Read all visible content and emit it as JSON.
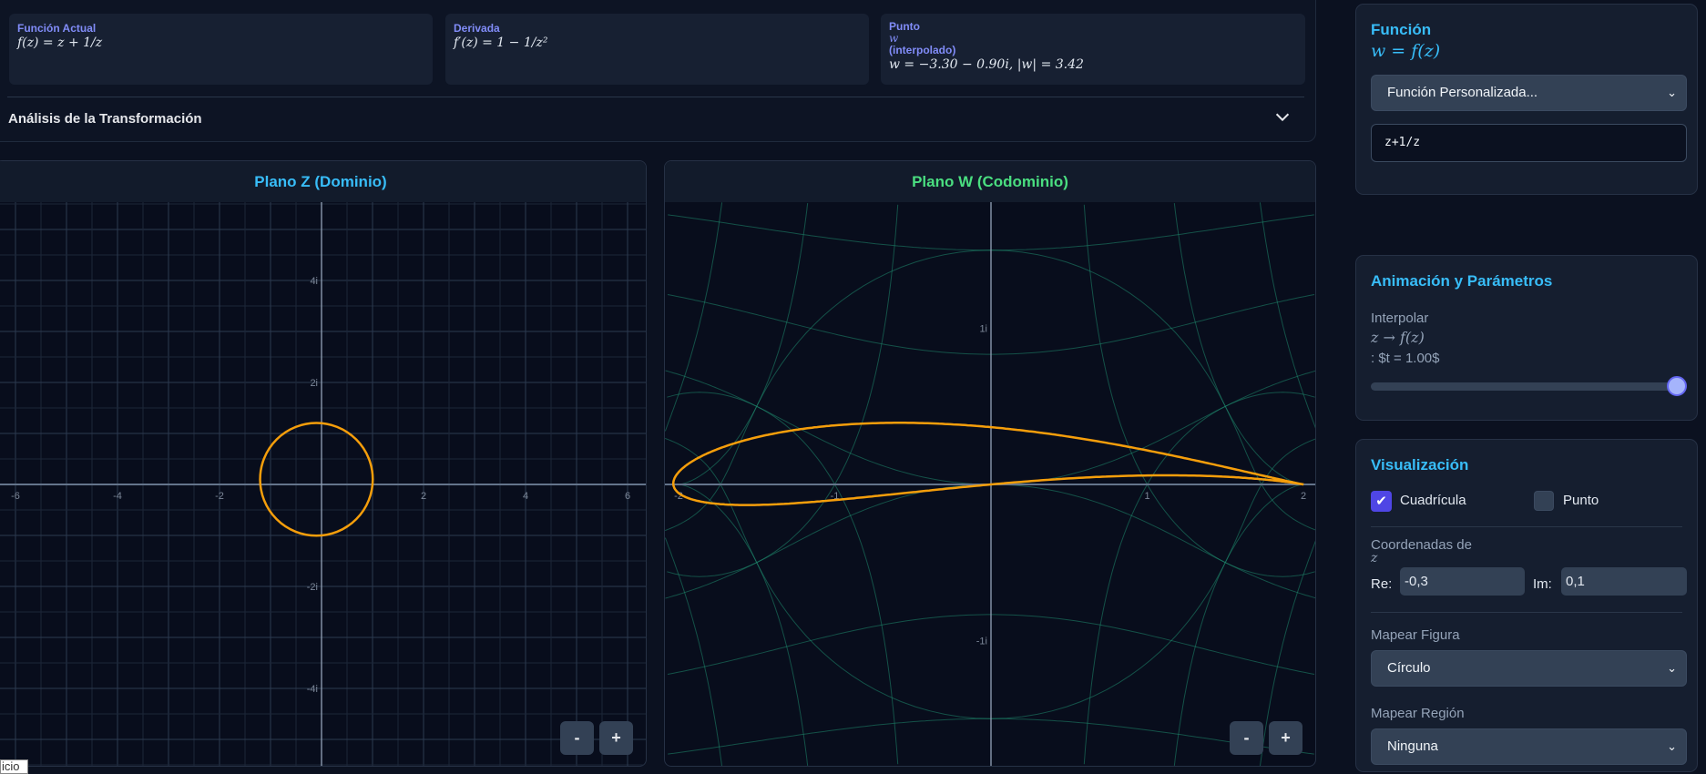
{
  "analysis": {
    "cards": [
      {
        "label": "Función Actual",
        "value": "f(z) = z + 1/z"
      },
      {
        "label": "Derivada",
        "value": "f′(z) = 1 − 1/z²"
      },
      {
        "label_line1": "Punto",
        "label_math": "w",
        "label_line2": "(interpolado)",
        "value": "w = −3.30 − 0.90i, |w| = 3.42"
      }
    ],
    "title": "Análisis de la Transformación",
    "toggle_icon": "chevron-down-icon"
  },
  "z_plane": {
    "title": "Plano Z (Dominio)",
    "x_ticks": [
      "-6",
      "-4",
      "-2",
      "2",
      "4",
      "6"
    ],
    "y_ticks": [
      "4i",
      "2i",
      "-2i",
      "-4i"
    ],
    "zoom_out": "-",
    "zoom_in": "+"
  },
  "w_plane": {
    "title": "Plano W (Codominio)",
    "x_ticks": [
      "-2",
      "-1",
      "1",
      "2"
    ],
    "y_ticks": [
      "1i",
      "-1i"
    ],
    "zoom_out": "-",
    "zoom_in": "+"
  },
  "tooltip": "icio",
  "sidebar": {
    "funcion": {
      "title": "Función",
      "subtitle_math": "w = f(z)",
      "select_value": "Función Personalizada...",
      "input_value": "z+1/z"
    },
    "animacion": {
      "title": "Animación y Parámetros",
      "interp_label": "Interpolar",
      "interp_math": "z → f(z)",
      "interp_value": ": $t = 1.00$",
      "slider_value": 1.0
    },
    "visualizacion": {
      "title": "Visualización",
      "grid_label": "Cuadrícula",
      "grid_checked": true,
      "point_label": "Punto",
      "point_checked": false,
      "coords_label": "Coordenadas de",
      "coords_math": "z",
      "re_label": "Re:",
      "re_value": "-0,3",
      "im_label": "Im:",
      "im_value": "0,1",
      "figure_label": "Mapear Figura",
      "figure_value": "Círculo",
      "region_label": "Mapear Región",
      "region_value": "Ninguna"
    }
  },
  "colors": {
    "accent": "#38bdf8",
    "w_title": "#4ade80",
    "label": "#818cf8",
    "curve": "#f59e0b",
    "mapped_grid": "#1f8a6e",
    "checkbox": "#4f46e5"
  }
}
